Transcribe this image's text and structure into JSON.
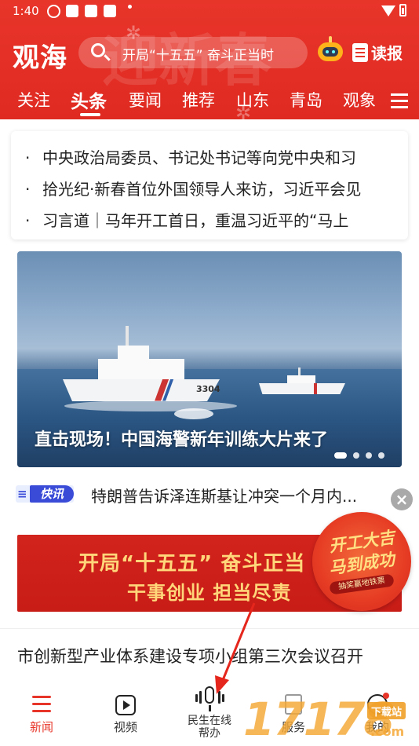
{
  "status_bar": {
    "time": "1:40"
  },
  "header": {
    "logo": "观海",
    "search_placeholder": "开局“十五五” 奋斗正当时",
    "read_paper": "读报",
    "theme_color": "#e8352a"
  },
  "channels": [
    {
      "label": "关注",
      "active": false
    },
    {
      "label": "头条",
      "active": true
    },
    {
      "label": "要闻",
      "active": false
    },
    {
      "label": "推荐",
      "active": false
    },
    {
      "label": "山东",
      "active": false
    },
    {
      "label": "青岛",
      "active": false
    },
    {
      "label": "观象",
      "active": false
    }
  ],
  "headlines": [
    "中央政治局委员、书记处书记等向党中央和习",
    "拾光纪·新春首位外国领导人来访，习近平会见",
    "习言道｜马年开工首日，重温习近平的“马上"
  ],
  "carousel": {
    "caption": "直击现场！中国海警新年训练大片来了",
    "ship_number": "3304",
    "slides": 4,
    "active_slide": 1
  },
  "flash": {
    "badge": "快讯",
    "text": "特朗普告诉泽连斯基让冲突一个月内..."
  },
  "banner": {
    "line1": "开局“十五五” 奋斗正当",
    "line2": "干事创业 担当尽责"
  },
  "promo": {
    "line1": "开工大吉",
    "line2": "马到成功",
    "tag": "抽奖赢地铁票"
  },
  "article": {
    "title": "市创新型产业体系建设专项小组第三次会议召开"
  },
  "bottom_nav": [
    {
      "label": "新闻",
      "icon": "news-icon",
      "active": true
    },
    {
      "label": "视频",
      "icon": "video-icon",
      "active": false
    },
    {
      "label": "民生在线帮办",
      "icon": "microphone-icon",
      "active": false
    },
    {
      "label": "服务",
      "icon": "service-icon",
      "active": false
    },
    {
      "label": "我的",
      "icon": "profile-icon",
      "active": false
    }
  ],
  "watermark": {
    "digits": "17178",
    "tag": "下载站",
    "domain": ".com"
  }
}
